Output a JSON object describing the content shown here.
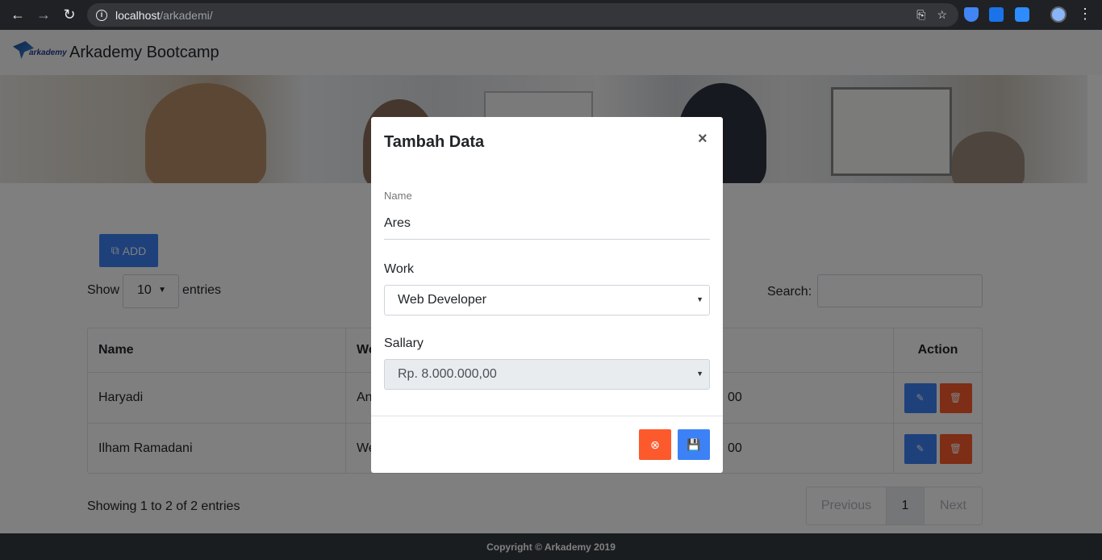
{
  "browser": {
    "url_host": "localhost",
    "url_path": "/arkademi/"
  },
  "navbar": {
    "logo_text": "arkademy",
    "brand": "Arkademy Bootcamp"
  },
  "toolbar": {
    "add_label": "ADD",
    "show_label": "Show",
    "page_length": "10",
    "entries_label": "entries",
    "search_label": "Search:"
  },
  "table": {
    "headers": [
      "Name",
      "Wo",
      "Action"
    ],
    "rows": [
      {
        "name": "Haryadi",
        "work": "An",
        "sallary": "00"
      },
      {
        "name": "Ilham Ramadani",
        "work": "We",
        "sallary": "00"
      }
    ]
  },
  "info": "Showing 1 to 2 of 2 entries",
  "pager": {
    "prev": "Previous",
    "page": "1",
    "next": "Next"
  },
  "footer": "Copyright © Arkademy 2019",
  "modal": {
    "title": "Tambah Data",
    "close": "×",
    "name_label": "Name",
    "name_value": "Ares",
    "work_label": "Work",
    "work_value": "Web Developer",
    "sallary_label": "Sallary",
    "sallary_value": "Rp. 8.000.000,00"
  },
  "colors": {
    "primary": "#3c82f6",
    "danger": "#fc5a2c",
    "footer_bg": "#343a40"
  }
}
